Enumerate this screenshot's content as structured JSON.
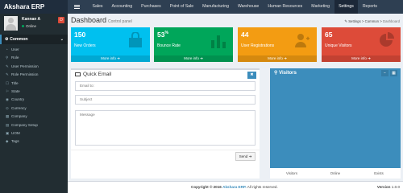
{
  "app": {
    "logo": "Akshara ERP"
  },
  "topnav": {
    "items": [
      "Sales",
      "Accounting",
      "Purchases",
      "Point of Sale",
      "Manufacturing",
      "Warehouse",
      "Human Resources",
      "Marketing",
      "Settings",
      "Reports"
    ],
    "active": "Settings"
  },
  "user": {
    "name": "Kannan A",
    "status": "Online"
  },
  "sidebar": {
    "section": "Common",
    "items": [
      {
        "icon": "user-icon",
        "label": "User"
      },
      {
        "icon": "role-icon",
        "label": "Role"
      },
      {
        "icon": "permission-icon",
        "label": "User Permission"
      },
      {
        "icon": "permission-icon",
        "label": "Role Permission"
      },
      {
        "icon": "title-icon",
        "label": "Title"
      },
      {
        "icon": "state-icon",
        "label": "State"
      },
      {
        "icon": "country-icon",
        "label": "Country"
      },
      {
        "icon": "currency-icon",
        "label": "Currency"
      },
      {
        "icon": "company-icon",
        "label": "Company"
      },
      {
        "icon": "setup-icon",
        "label": "Company Setup"
      },
      {
        "icon": "uom-icon",
        "label": "UOM"
      },
      {
        "icon": "tags-icon",
        "label": "Tags"
      }
    ]
  },
  "page": {
    "title": "Dashboard",
    "subtitle": "Control panel",
    "breadcrumb": [
      "Settings",
      "Common",
      "Dashboard"
    ]
  },
  "stats": [
    {
      "value": "150",
      "suffix": "",
      "label": "New Orders",
      "link": "More info",
      "color": "#00c0ef",
      "icon": "shopping-bag-icon"
    },
    {
      "value": "53",
      "suffix": "%",
      "label": "Bounce Rate",
      "link": "More info",
      "color": "#00a65a",
      "icon": "bar-chart-icon"
    },
    {
      "value": "44",
      "suffix": "",
      "label": "User Registrations",
      "link": "More info",
      "color": "#f39c12",
      "icon": "user-add-icon"
    },
    {
      "value": "65",
      "suffix": "",
      "label": "Unique Visitors",
      "link": "More info",
      "color": "#dd4b39",
      "icon": "pie-chart-icon"
    }
  ],
  "quick_email": {
    "title": "Quick Email",
    "email_placeholder": "Email to:",
    "subject_placeholder": "Subject",
    "message_placeholder": "Message",
    "send_label": "Send"
  },
  "visitors": {
    "title": "Visitors",
    "footer": [
      "Visitors",
      "Online",
      "Exists"
    ]
  },
  "footer": {
    "copyright_prefix": "Copyright © 2016",
    "company": "Akshara ERP.",
    "rights": "All rights reserved.",
    "version_label": "Version",
    "version": "1.0.0"
  }
}
